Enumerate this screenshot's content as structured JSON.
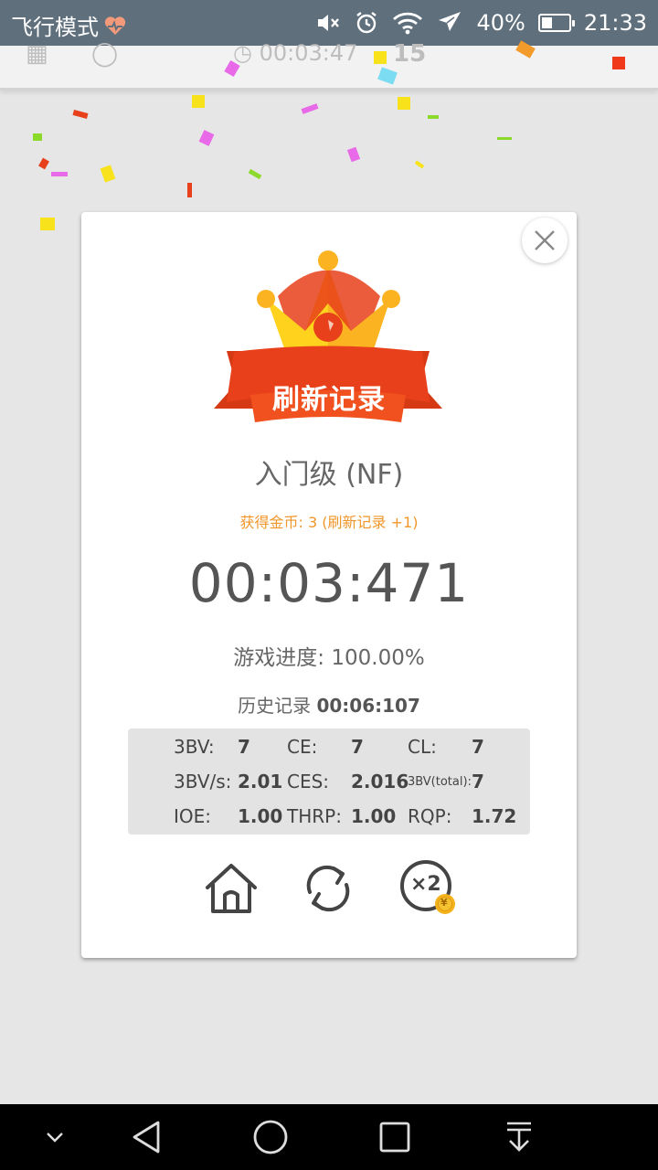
{
  "status_bar": {
    "left_text": "飞行模式",
    "battery_percent": "40%",
    "battery_level": 0.4,
    "time": "21:33",
    "icons": [
      "heart-icon",
      "mute-icon",
      "alarm-icon",
      "wifi-icon",
      "airplane-icon",
      "battery-icon"
    ]
  },
  "background_header": {
    "timer_text": "00:03:47",
    "count_text": "15"
  },
  "dialog": {
    "banner": "刷新记录",
    "level": "入门级 (NF)",
    "coins": "获得金币: 3 (刷新记录 +1)",
    "timer": "00:03:471",
    "progress_label": "游戏进度:",
    "progress_value": "100.00%",
    "history_label": "历史记录",
    "history_value": "00:06:107",
    "stats": [
      {
        "label": "3BV:",
        "value": "7"
      },
      {
        "label": "CE:",
        "value": "7"
      },
      {
        "label": "CL:",
        "value": "7"
      },
      {
        "label": "3BV/s:",
        "value": "2.01"
      },
      {
        "label": "CES:",
        "value": "2.016"
      },
      {
        "label": "3BV(total):",
        "value": "7"
      },
      {
        "label": "IOE:",
        "value": "1.00"
      },
      {
        "label": "THRP:",
        "value": "1.00"
      },
      {
        "label": "RQP:",
        "value": "1.72"
      }
    ],
    "actions": [
      "home-icon",
      "restart-icon",
      "double-coins-icon"
    ],
    "double_label": "×2",
    "coin_symbol": "¥"
  },
  "colors": {
    "status_bar": "#5f6f7c",
    "ribbon": "#e8401a",
    "crown": "#fbb321",
    "coins_text": "#f0962a",
    "overlay_bg": "#e6e6e6"
  }
}
